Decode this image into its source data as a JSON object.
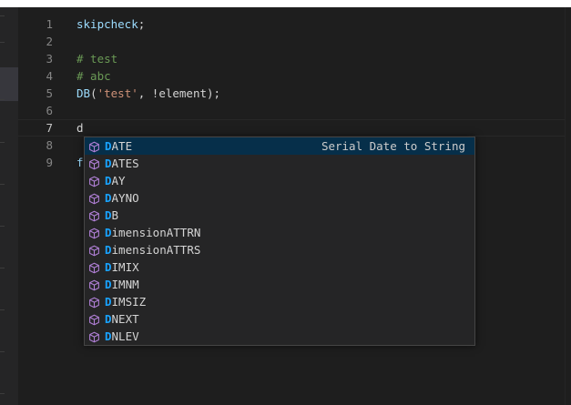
{
  "editor": {
    "lines": [
      {
        "number": "1",
        "tokens": [
          {
            "text": "skipcheck",
            "kind": "ident"
          },
          {
            "text": ";",
            "kind": "plain"
          }
        ]
      },
      {
        "number": "2",
        "tokens": []
      },
      {
        "number": "3",
        "tokens": [
          {
            "text": "# test",
            "kind": "comment"
          }
        ]
      },
      {
        "number": "4",
        "tokens": [
          {
            "text": "# abc",
            "kind": "comment"
          }
        ]
      },
      {
        "number": "5",
        "tokens": [
          {
            "text": "DB",
            "kind": "ident"
          },
          {
            "text": "(",
            "kind": "plain"
          },
          {
            "text": "'test'",
            "kind": "string"
          },
          {
            "text": ", !element);",
            "kind": "plain"
          }
        ]
      },
      {
        "number": "6",
        "tokens": []
      },
      {
        "number": "7",
        "tokens": [
          {
            "text": "d",
            "kind": "plain"
          }
        ],
        "current": true
      },
      {
        "number": "8",
        "tokens": []
      },
      {
        "number": "9",
        "tokens": [
          {
            "text": "f",
            "kind": "ident"
          }
        ]
      }
    ]
  },
  "suggestions": {
    "typed_prefix": "d",
    "icon": "cube-icon",
    "items": [
      {
        "match": "D",
        "rest": "ATE",
        "detail": "Serial Date to String",
        "selected": true
      },
      {
        "match": "D",
        "rest": "ATES"
      },
      {
        "match": "D",
        "rest": "AY"
      },
      {
        "match": "D",
        "rest": "AYNO"
      },
      {
        "match": "D",
        "rest": "B"
      },
      {
        "match": "D",
        "rest": "imensionATTRN"
      },
      {
        "match": "D",
        "rest": "imensionATTRS"
      },
      {
        "match": "D",
        "rest": "IMIX"
      },
      {
        "match": "D",
        "rest": "IMNM"
      },
      {
        "match": "D",
        "rest": "IMSIZ"
      },
      {
        "match": "D",
        "rest": "NEXT"
      },
      {
        "match": "D",
        "rest": "NLEV"
      }
    ]
  },
  "colors": {
    "background": "#1e1e1e",
    "widget_background": "#252526",
    "selected_row": "#062f4a",
    "match_highlight": "#18a3ff",
    "icon": "#b180d7"
  }
}
